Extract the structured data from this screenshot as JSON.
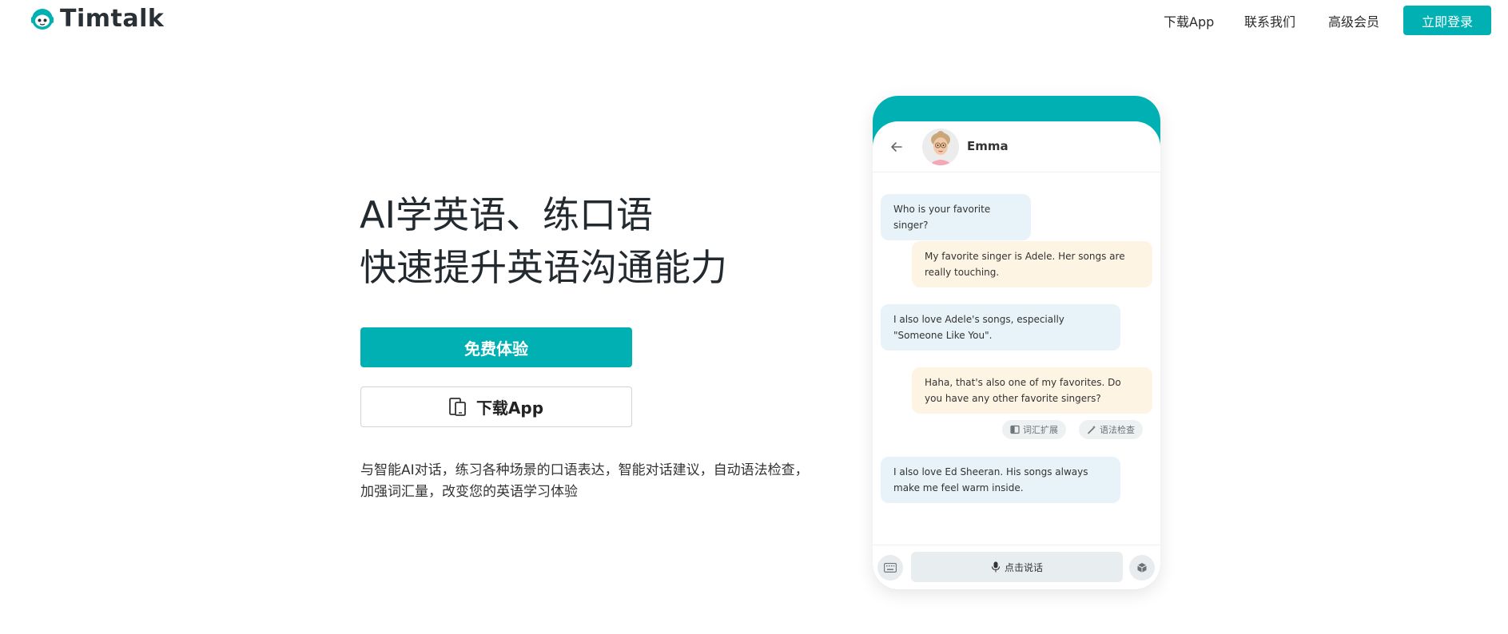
{
  "header": {
    "brand": "Timtalk",
    "nav": [
      {
        "label": "下载App"
      },
      {
        "label": "联系我们"
      },
      {
        "label": "高级会员"
      }
    ],
    "login_label": "立即登录"
  },
  "hero": {
    "title_line1": "AI学英语、练口语",
    "title_line2": "快速提升英语沟通能力",
    "primary_cta": "免费体验",
    "secondary_cta": "下载App",
    "description": "与智能AI对话，练习各种场景的口语表达，智能对话建议，自动语法检查，加强词汇量，改变您的英语学习体验"
  },
  "chat": {
    "contact_name": "Emma",
    "messages": [
      {
        "role": "ai",
        "text": "Who is your favorite singer?"
      },
      {
        "role": "user",
        "text": "My favorite singer is Adele. Her songs are really touching."
      },
      {
        "role": "ai",
        "text": "I also love Adele's songs, especially \"Someone Like You\"."
      },
      {
        "role": "user",
        "text": "Haha, that's also one of my favorites. Do you have any other favorite singers?"
      },
      {
        "role": "ai",
        "text": "I also love Ed Sheeran. His songs always make me feel warm inside."
      }
    ],
    "tools": {
      "vocab_label": "词汇扩展",
      "grammar_label": "语法检查"
    },
    "speak_label": "点击说话"
  },
  "colors": {
    "accent": "#00b0b2",
    "ai_bubble": "#e7f3f8",
    "user_bubble": "#fdf4e4"
  }
}
